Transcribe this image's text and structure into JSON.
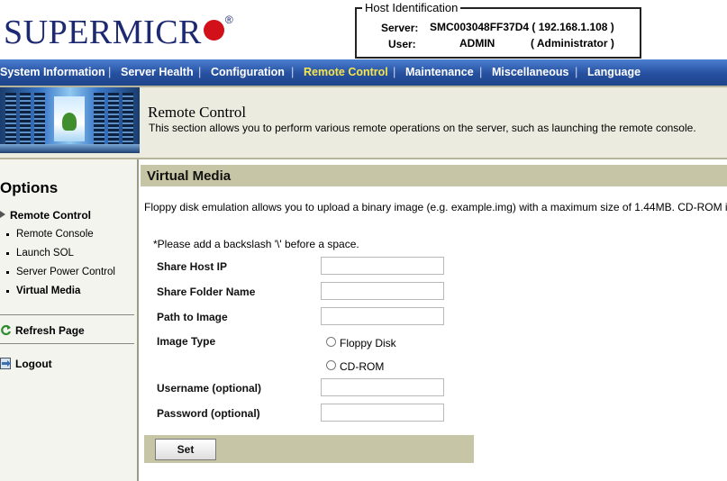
{
  "brand": {
    "logo_text": "SUPERMICR",
    "trademark": "®"
  },
  "host_identification": {
    "legend": "Host Identification",
    "server_label": "Server:",
    "server_value": "SMC003048FF37D4 ( 192.168.1.108 )",
    "user_label": "User:",
    "user_name": "ADMIN",
    "user_role": "( Administrator )"
  },
  "nav": {
    "items": [
      {
        "label": "System Information"
      },
      {
        "label": "Server Health"
      },
      {
        "label": "Configuration"
      },
      {
        "label": "Remote Control",
        "active": true
      },
      {
        "label": "Maintenance"
      },
      {
        "label": "Miscellaneous"
      },
      {
        "label": "Language"
      }
    ],
    "active_color": "#f7e54d"
  },
  "banner": {
    "title": "Remote Control",
    "description": "This section allows you to perform various remote operations on the server, such as launching the remote console."
  },
  "sidebar": {
    "title": "Options",
    "section": "Remote Control",
    "items": [
      {
        "label": "Remote Console"
      },
      {
        "label": "Launch SOL"
      },
      {
        "label": "Server Power Control"
      },
      {
        "label": "Virtual Media",
        "selected": true
      }
    ],
    "refresh": "Refresh Page",
    "logout": "Logout"
  },
  "panel": {
    "title": "Virtual Media",
    "description": "Floppy disk emulation allows you to upload a binary image (e.g. example.img) with a maximum size of 1.44MB. CD-ROM i",
    "note": "*Please add a backslash '\\' before a space.",
    "fields": {
      "share_host_ip": {
        "label": "Share Host IP",
        "value": ""
      },
      "share_folder": {
        "label": "Share Folder Name",
        "value": ""
      },
      "path_to_image": {
        "label": "Path to Image",
        "value": ""
      },
      "image_type": {
        "label": "Image Type",
        "options": [
          "Floppy Disk",
          "CD-ROM"
        ]
      },
      "username": {
        "label": "Username (optional)",
        "value": ""
      },
      "password": {
        "label": "Password (optional)",
        "value": ""
      }
    },
    "set_button": "Set"
  },
  "colors": {
    "brand_blue": "#1d2a72",
    "brand_red": "#d2101a",
    "nav_blue": "#254f9f",
    "panel_header": "#c6c5a5"
  }
}
